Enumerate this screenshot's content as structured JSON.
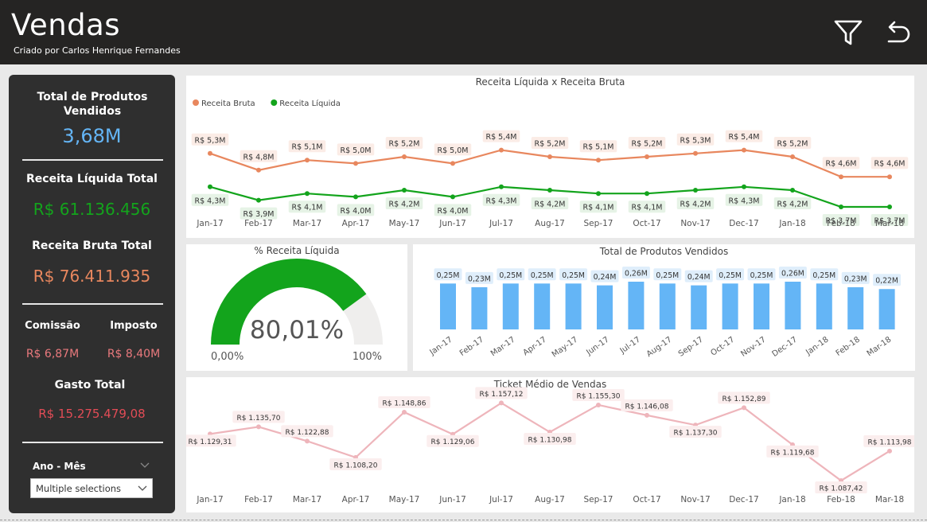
{
  "header": {
    "title": "Vendas",
    "subtitle": "Criado por Carlos Henrique Fernandes"
  },
  "sidebar": {
    "produtos_label": "Total de Produtos Vendidos",
    "produtos_value": "3,68M",
    "receita_liquida_label": "Receita Líquida Total",
    "receita_liquida_value": "R$ 61.136.456",
    "receita_bruta_label": "Receita Bruta Total",
    "receita_bruta_value": "R$ 76.411.935",
    "comissao_label": "Comissão",
    "comissao_value": "R$ 6,87M",
    "imposto_label": "Imposto",
    "imposto_value": "R$ 8,40M",
    "gasto_label": "Gasto Total",
    "gasto_value": "R$ 15.275.479,08",
    "filter_label": "Ano - Mês",
    "filter_value": "Multiple selections"
  },
  "colors": {
    "bruta": "#e8875e",
    "liquida": "#13a41c",
    "bars": "#64b5f6",
    "ticket": "#eeb5bb",
    "produtos": "#64b5f6",
    "comissao": "#e9797d",
    "gasto": "#e24c56"
  },
  "chart_data": [
    {
      "type": "line",
      "title": "Receita Líquida x Receita Bruta",
      "categories": [
        "Jan-17",
        "Feb-17",
        "Mar-17",
        "Apr-17",
        "May-17",
        "Jun-17",
        "Jul-17",
        "Aug-17",
        "Sep-17",
        "Oct-17",
        "Nov-17",
        "Dec-17",
        "Jan-18",
        "Feb-18",
        "Mar-18"
      ],
      "series": [
        {
          "name": "Receita Bruta",
          "values": [
            5.3,
            4.8,
            5.1,
            5.0,
            5.2,
            5.0,
            5.4,
            5.2,
            5.1,
            5.2,
            5.3,
            5.4,
            5.2,
            4.6,
            4.6
          ],
          "labels": [
            "R$ 5,3M",
            "R$ 4,8M",
            "R$ 5,1M",
            "R$ 5,0M",
            "R$ 5,2M",
            "R$ 5,0M",
            "R$ 5,4M",
            "R$ 5,2M",
            "R$ 5,1M",
            "R$ 5,2M",
            "R$ 5,3M",
            "R$ 5,4M",
            "R$ 5,2M",
            "R$ 4,6M",
            "R$ 4,6M"
          ]
        },
        {
          "name": "Receita Líquida",
          "values": [
            4.3,
            3.9,
            4.1,
            4.0,
            4.2,
            4.0,
            4.3,
            4.2,
            4.1,
            4.1,
            4.2,
            4.3,
            4.2,
            3.7,
            3.7
          ],
          "labels": [
            "R$ 4,3M",
            "R$ 3,9M",
            "R$ 4,1M",
            "R$ 4,0M",
            "R$ 4,2M",
            "R$ 4,0M",
            "R$ 4,3M",
            "R$ 4,2M",
            "R$ 4,1M",
            "R$ 4,1M",
            "R$ 4,2M",
            "R$ 4,3M",
            "R$ 4,2M",
            "R$ 3,7M",
            "R$ 3,7M"
          ]
        }
      ],
      "legend": "top-left",
      "grid": false
    },
    {
      "type": "gauge",
      "title": "% Receita Líquida",
      "value": 80.01,
      "value_label": "80,01%",
      "min_label": "0,00%",
      "max_label": "100%",
      "range": [
        0,
        100
      ]
    },
    {
      "type": "bar",
      "title": "Total de Produtos Vendidos",
      "categories": [
        "Jan-17",
        "Feb-17",
        "Mar-17",
        "Apr-17",
        "May-17",
        "Jun-17",
        "Jul-17",
        "Aug-17",
        "Sep-17",
        "Oct-17",
        "Nov-17",
        "Dec-17",
        "Jan-18",
        "Feb-18",
        "Mar-18"
      ],
      "values": [
        0.25,
        0.23,
        0.25,
        0.25,
        0.25,
        0.24,
        0.26,
        0.25,
        0.24,
        0.25,
        0.25,
        0.26,
        0.25,
        0.23,
        0.22
      ],
      "labels": [
        "0,25M",
        "0,23M",
        "0,25M",
        "0,25M",
        "0,25M",
        "0,24M",
        "0,26M",
        "0,25M",
        "0,24M",
        "0,25M",
        "0,25M",
        "0,26M",
        "0,25M",
        "0,23M",
        "0,22M"
      ],
      "ylim": [
        0,
        0.26
      ]
    },
    {
      "type": "line",
      "title": "Ticket Médio de Vendas",
      "categories": [
        "Jan-17",
        "Feb-17",
        "Mar-17",
        "Apr-17",
        "May-17",
        "Jun-17",
        "Jul-17",
        "Aug-17",
        "Sep-17",
        "Oct-17",
        "Nov-17",
        "Dec-17",
        "Jan-18",
        "Feb-18",
        "Mar-18"
      ],
      "values": [
        1129.31,
        1135.7,
        1122.88,
        1108.2,
        1148.86,
        1129.06,
        1157.12,
        1130.98,
        1155.3,
        1146.08,
        1137.3,
        1152.89,
        1119.68,
        1087.42,
        1113.98
      ],
      "labels": [
        "R$ 1.129,31",
        "R$ 1.135,70",
        "R$ 1.122,88",
        "R$ 1.108,20",
        "R$ 1.148,86",
        "R$ 1.129,06",
        "R$ 1.157,12",
        "R$ 1.130,98",
        "R$ 1.155,30",
        "R$ 1.146,08",
        "R$ 1.137,30",
        "R$ 1.152,89",
        "R$ 1.119,68",
        "R$ 1.087,42",
        "R$ 1.113,98"
      ],
      "grid": false
    }
  ]
}
